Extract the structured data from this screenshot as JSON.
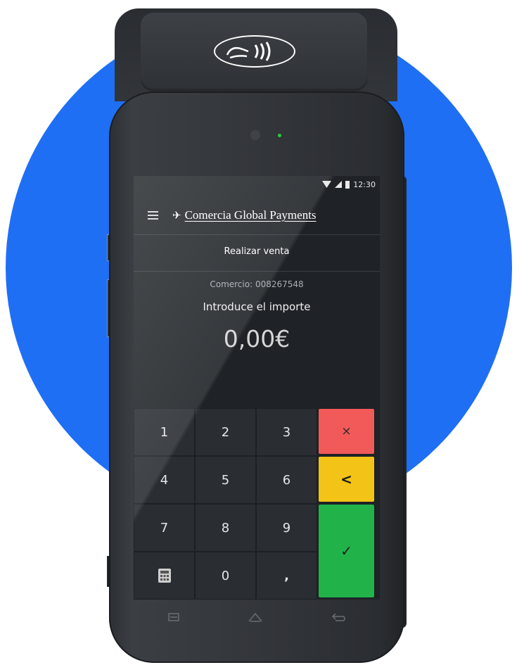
{
  "status_bar": {
    "time": "12:30",
    "icons": [
      "wifi-icon",
      "signal-icon",
      "battery-icon"
    ]
  },
  "header": {
    "logo_glyph": "✈",
    "brand_name": "Comercia Global Payments",
    "menu_icon": "hamburger-menu-icon"
  },
  "page": {
    "title": "Realizar venta",
    "merchant": "Comercio: 008267548",
    "prompt": "Introduce el importe",
    "amount": "0,00€"
  },
  "keypad": {
    "keys": [
      "1",
      "2",
      "3",
      "4",
      "5",
      "6",
      "7",
      "8",
      "9",
      "0",
      ","
    ],
    "calculator_icon": "calculator-icon",
    "cancel_label": "×",
    "backspace_label": "<",
    "confirm_label": "✓"
  },
  "nav": {
    "icons": [
      "menu-nav-icon",
      "home-nav-icon",
      "back-nav-icon"
    ]
  },
  "colors": {
    "background_circle": "#1f6ff4",
    "cancel": "#f25a5a",
    "backspace": "#f3c318",
    "confirm": "#21b34a",
    "screen": "#1f2327"
  }
}
